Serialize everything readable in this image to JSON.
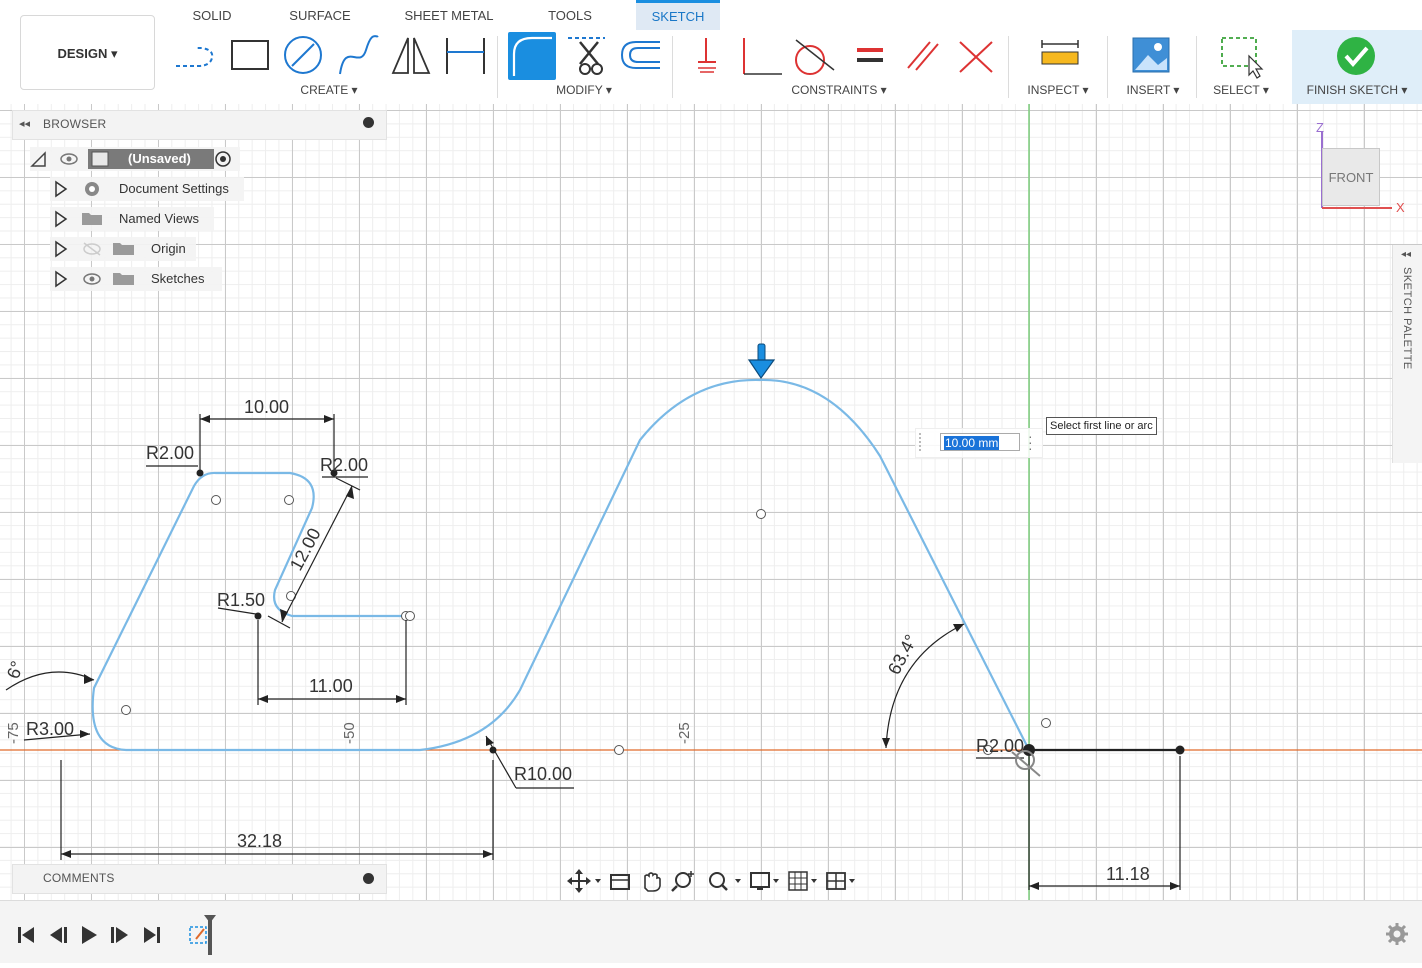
{
  "tabs": [
    {
      "label": "SOLID",
      "active": false
    },
    {
      "label": "SURFACE",
      "active": false
    },
    {
      "label": "SHEET METAL",
      "active": false
    },
    {
      "label": "TOOLS",
      "active": false
    },
    {
      "label": "SKETCH",
      "active": true
    }
  ],
  "workspace": {
    "label": "DESIGN ▾"
  },
  "toolbar_groups": {
    "create": "CREATE ▾",
    "modify": "MODIFY ▾",
    "constraints": "CONSTRAINTS ▾",
    "inspect": "INSPECT ▾",
    "insert": "INSERT ▾",
    "select": "SELECT ▾",
    "finish": "FINISH SKETCH ▾"
  },
  "accent_color": "#1a8ee0",
  "browser": {
    "title": "BROWSER",
    "root": "(Unsaved)",
    "items": [
      {
        "label": "Document Settings",
        "icon": "gear-icon"
      },
      {
        "label": "Named Views",
        "icon": "folder-icon"
      },
      {
        "label": "Origin",
        "icon": "folder-icon"
      },
      {
        "label": "Sketches",
        "icon": "folder-icon"
      }
    ]
  },
  "comments": {
    "title": "COMMENTS"
  },
  "viewcube": {
    "face": "FRONT",
    "axis_z": "Z",
    "axis_x": "X"
  },
  "palette": {
    "title": "SKETCH PALETTE"
  },
  "fillet_input": {
    "value": "10.00 mm"
  },
  "tooltip": "Select first line or arc",
  "dimensions": {
    "d_top_width": "10.00",
    "r_left_top": "R2.00",
    "r_right_top": "R2.00",
    "d_slant": "12.00",
    "r_inner": "R1.50",
    "d_inner_width": "11.00",
    "angle_left": "6°",
    "r_left_bottom": "R3.00",
    "r_fillet_10": "R10.00",
    "d_bottom_left": "32.18",
    "angle_right": "63.4°",
    "r_right_bottom": "R2.00",
    "d_bottom_right": "11.18",
    "axis_n50": "-50",
    "axis_n25": "-25",
    "axis_n75": "-75"
  }
}
